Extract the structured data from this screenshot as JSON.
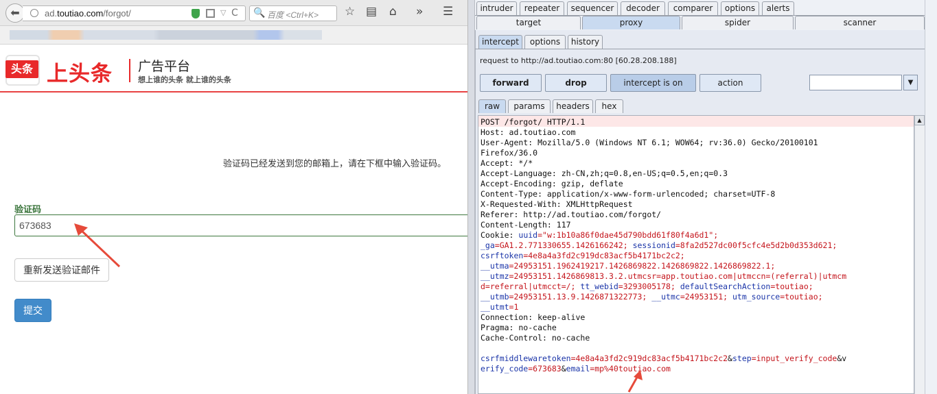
{
  "browser": {
    "url_prefix": "ad.",
    "url_host": "toutiao.com",
    "url_path": "/forgot/",
    "search_placeholder": "百度 <Ctrl+K>",
    "icons": {
      "back": "arrow-left-icon",
      "globe": "globe-icon",
      "shield": "shield-icon",
      "qr": "qr-code-icon",
      "dropdown": "chevron-down-icon",
      "reload": "reload-icon",
      "search": "search-icon",
      "bookmark": "star-icon",
      "reader": "reader-icon",
      "home": "home-icon",
      "overflow": "double-chevron-icon",
      "menu": "hamburger-icon"
    },
    "glyphs": {
      "back": "⬅",
      "dropdown": "▽",
      "reload": "C",
      "search": "🔍",
      "bookmark": "☆",
      "reader": "▤",
      "home": "⌂",
      "overflow": "»",
      "menu": "☰"
    }
  },
  "page": {
    "logo_badge": "头条",
    "logo_title": "上头条",
    "logo_platform": "广告平台",
    "logo_slogan": "想上谁的头条   就上谁的头条",
    "info_text": "验证码已经发送到您的邮箱上，请在下框中输入验证码。",
    "code_label": "验证码",
    "code_value": "673683",
    "resend_label": "重新发送验证邮件",
    "submit_label": "提交",
    "colors": {
      "brand_red": "#e8292a",
      "label_green": "#3c763d",
      "submit_blue": "#428bca"
    }
  },
  "burp": {
    "tabs_row1": [
      "intruder",
      "repeater",
      "sequencer",
      "decoder",
      "comparer",
      "options",
      "alerts"
    ],
    "tabs_row2": [
      "target",
      "proxy",
      "spider",
      "scanner"
    ],
    "proxy_tabs": [
      "intercept",
      "options",
      "history"
    ],
    "request_to": "request to http://ad.toutiao.com:80  [60.28.208.188]",
    "buttons": {
      "forward": "forward",
      "drop": "drop",
      "intercept": "intercept is on",
      "action": "action"
    },
    "view_tabs": [
      "raw",
      "params",
      "headers",
      "hex"
    ],
    "scroll_up_glyph": "▲",
    "combo_arrow_glyph": "▼",
    "request_lines": [
      "POST /forgot/ HTTP/1.1",
      "Host: ad.toutiao.com",
      "User-Agent: Mozilla/5.0 (Windows NT 6.1; WOW64; rv:36.0) Gecko/20100101",
      "Firefox/36.0",
      "Accept: */*",
      "Accept-Language: zh-CN,zh;q=0.8,en-US;q=0.5,en;q=0.3",
      "Accept-Encoding: gzip, deflate",
      "Content-Type: application/x-www-form-urlencoded; charset=UTF-8",
      "X-Requested-With: XMLHttpRequest",
      "Referer: http://ad.toutiao.com/forgot/",
      "Content-Length: 117"
    ],
    "cookie_lines": [
      [
        {
          "t": "Cookie: ",
          "c": "p"
        },
        {
          "t": "uuid",
          "c": "k"
        },
        {
          "t": "=\"w:1b10a86f0dae45d790bdd61f80f4a6d1\";",
          "c": "v"
        }
      ],
      [
        {
          "t": "_ga",
          "c": "k"
        },
        {
          "t": "=GA1.2.771330655.1426166242; ",
          "c": "v"
        },
        {
          "t": "sessionid",
          "c": "k"
        },
        {
          "t": "=8fa2d527dc00f5cfc4e5d2b0d353d621;",
          "c": "v"
        }
      ],
      [
        {
          "t": "csrftoken",
          "c": "k"
        },
        {
          "t": "=4e8a4a3fd2c919dc83acf5b4171bc2c2;",
          "c": "v"
        }
      ],
      [
        {
          "t": "__utma",
          "c": "k"
        },
        {
          "t": "=24953151.1962419217.1426869822.1426869822.1426869822.1;",
          "c": "v"
        }
      ],
      [
        {
          "t": "__utmz",
          "c": "k"
        },
        {
          "t": "=24953151.1426869813.3.2.utmcsr=app.toutiao.com|utmccn=(referral)|utmcm",
          "c": "v"
        }
      ],
      [
        {
          "t": "d=referral|utmcct=/; ",
          "c": "v"
        },
        {
          "t": "tt_webid",
          "c": "k"
        },
        {
          "t": "=3293005178; ",
          "c": "v"
        },
        {
          "t": "defaultSearchAction",
          "c": "k"
        },
        {
          "t": "=toutiao;",
          "c": "v"
        }
      ],
      [
        {
          "t": "__utmb",
          "c": "k"
        },
        {
          "t": "=24953151.13.9.1426871322773; ",
          "c": "v"
        },
        {
          "t": "__utmc",
          "c": "k"
        },
        {
          "t": "=24953151; ",
          "c": "v"
        },
        {
          "t": "utm_source",
          "c": "k"
        },
        {
          "t": "=toutiao;",
          "c": "v"
        }
      ],
      [
        {
          "t": "__utmt",
          "c": "k"
        },
        {
          "t": "=1",
          "c": "v"
        }
      ]
    ],
    "tail_lines": [
      "Connection: keep-alive",
      "Pragma: no-cache",
      "Cache-Control: no-cache",
      ""
    ],
    "body_lines": [
      [
        {
          "t": "csrfmiddlewaretoken",
          "c": "k"
        },
        {
          "t": "=4e8a4a3fd2c919dc83acf5b4171bc2c2",
          "c": "v"
        },
        {
          "t": "&",
          "c": "p"
        },
        {
          "t": "step",
          "c": "k"
        },
        {
          "t": "=input_verify_code",
          "c": "v"
        },
        {
          "t": "&v",
          "c": "p"
        }
      ],
      [
        {
          "t": "erify_code",
          "c": "k"
        },
        {
          "t": "=673683",
          "c": "v"
        },
        {
          "t": "&",
          "c": "p"
        },
        {
          "t": "email",
          "c": "k"
        },
        {
          "t": "=mp%40toutiao.com",
          "c": "v"
        }
      ]
    ]
  }
}
